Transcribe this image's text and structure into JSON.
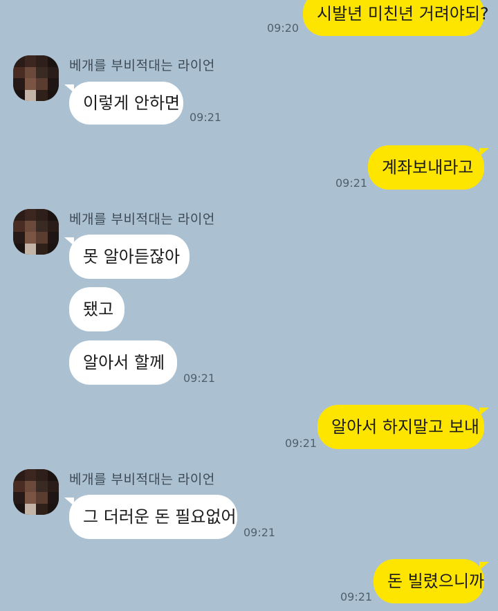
{
  "colors": {
    "background": "#abc1d1",
    "incoming_bubble": "#ffffff",
    "outgoing_bubble": "#fee500",
    "timestamp": "#4e5f6d"
  },
  "messages": [
    {
      "direction": "out",
      "text": "시발년 미친년 거려야되?",
      "time": "09:20"
    },
    {
      "sender": "베개를 부비적대는 라이언",
      "direction": "in",
      "text": "이렇게 안하면",
      "time": "09:21"
    },
    {
      "direction": "out",
      "text": "계좌보내라고",
      "time": "09:21"
    },
    {
      "sender": "베개를 부비적대는 라이언",
      "direction": "in",
      "text": "못 알아듣잖아"
    },
    {
      "direction": "in",
      "text": "됐고"
    },
    {
      "direction": "in",
      "text": "알아서 할께",
      "time": "09:21"
    },
    {
      "direction": "out",
      "text": "알아서 하지말고 보내",
      "time": "09:21"
    },
    {
      "sender": "베개를 부비적대는 라이언",
      "direction": "in",
      "text": "그 더러운 돈 필요없어",
      "time": "09:21"
    },
    {
      "direction": "out",
      "text": "돈 빌렸으니까",
      "time": "09:21"
    }
  ]
}
